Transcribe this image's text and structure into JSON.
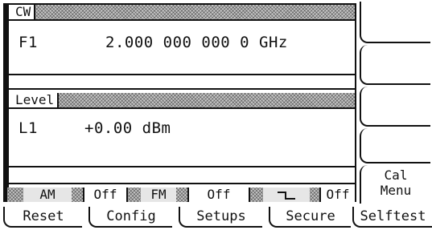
{
  "cw_panel": {
    "title": "CW",
    "param_label": "F1",
    "param_value": "2.000 000 000 0 GHz"
  },
  "level_panel": {
    "title": "Level",
    "param_label": "L1",
    "param_value": "+0.00 dBm"
  },
  "status_bar": {
    "am_label": "AM",
    "am_value": "Off",
    "fm_label": "FM",
    "fm_value": "Off",
    "pulse_icon": "pulse-modulation-icon",
    "pulse_value": "Off"
  },
  "softkeys": {
    "key1": "",
    "key2": "",
    "key3": "",
    "key4": "",
    "key5_line1": "Cal",
    "key5_line2": "Menu"
  },
  "bottom_keys": [
    "Reset",
    "Config",
    "Setups",
    "Secure",
    "Selftest"
  ]
}
